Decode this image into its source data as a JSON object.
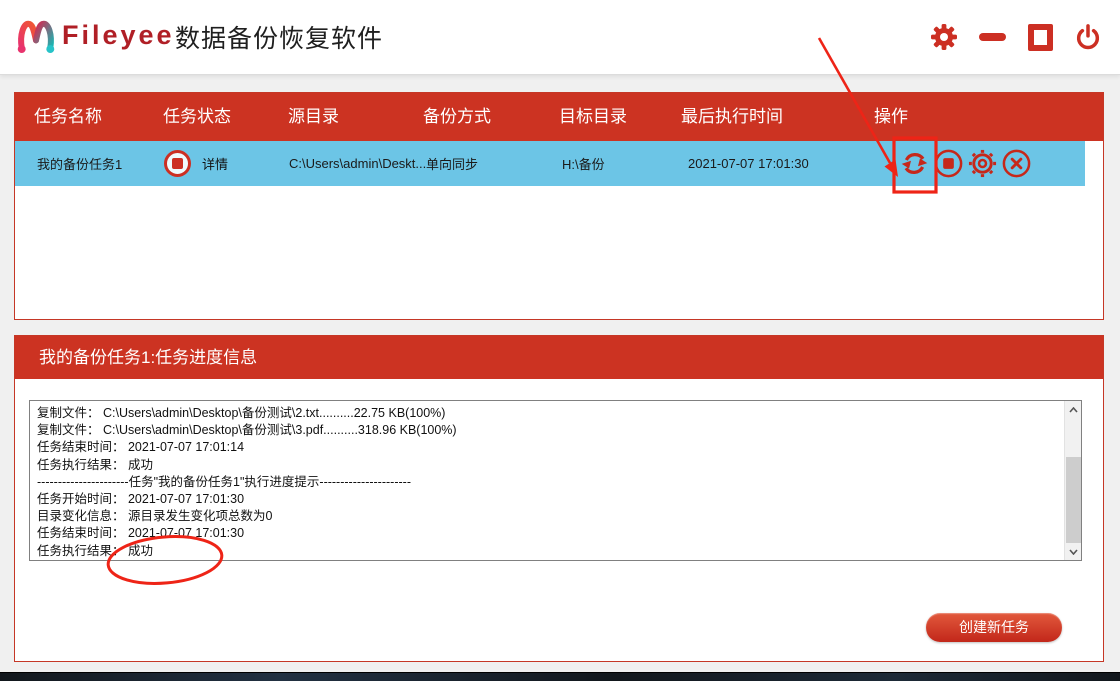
{
  "titlebar": {
    "brand": "Fileyee",
    "app_title": "数据备份恢复软件",
    "control_icons": [
      "settings-gear",
      "minimize",
      "maximize",
      "power-close"
    ]
  },
  "task_table": {
    "headers": [
      "任务名称",
      "任务状态",
      "源目录",
      "备份方式",
      "目标目录",
      "最后执行时间",
      "操作"
    ],
    "row": {
      "name": "我的备份任务1",
      "status_icon": "stop",
      "status_link": "详情",
      "source": "C:\\Users\\admin\\Deskt...",
      "method": "单向同步",
      "target": "H:\\备份",
      "last_run": "2021-07-07 17:01:30",
      "action_icons": [
        "refresh-sync",
        "stop",
        "settings-gear",
        "close"
      ]
    }
  },
  "progress_panel": {
    "title": "我的备份任务1:任务进度信息",
    "log_lines": [
      "复制文件： C:\\Users\\admin\\Desktop\\备份测试\\2.txt..........22.75 KB(100%)",
      "复制文件： C:\\Users\\admin\\Desktop\\备份测试\\3.pdf..........318.96 KB(100%)",
      "任务结束时间： 2021-07-07 17:01:14",
      "任务执行结果： 成功",
      "----------------------任务\"我的备份任务1\"执行进度提示----------------------",
      "任务开始时间： 2021-07-07 17:01:30",
      "目录变化信息： 源目录发生变化项总数为0",
      "任务结束时间： 2021-07-07 17:01:30",
      "任务执行结果： 成功"
    ],
    "create_task_button": "创建新任务"
  },
  "colors": {
    "accent_red": "#cc3322",
    "icon_red": "#cc2f23",
    "row_blue": "#6cc5e6",
    "annotation_red": "#ee2417",
    "brand_red": "#b01f26"
  }
}
